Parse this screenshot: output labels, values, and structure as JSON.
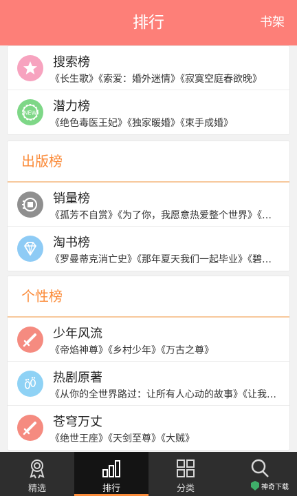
{
  "header": {
    "title": "排行",
    "shelf": "书架"
  },
  "card1": {
    "rows": [
      {
        "name": "搜索榜",
        "books": "《长生歌》《索爱：婚外迷情》《寂寞空庭春欲晚》",
        "icon": "star-icon",
        "color": "#f7a3bf"
      },
      {
        "name": "潜力榜",
        "books": "《绝色毒医王妃》《独家暖婚》《束手成婚》",
        "icon": "new-badge-icon",
        "color": "#7ed787"
      }
    ]
  },
  "publish": {
    "title": "出版榜",
    "rows": [
      {
        "name": "销量榜",
        "books": "《孤芳不自赏》《为了你，我愿意热爱整个世界》《…",
        "icon": "sales-ranking-icon",
        "color": "#8f8f8f"
      },
      {
        "name": "淘书榜",
        "books": "《罗曼蒂克消亡史》《那年夏天我们一起毕业》《碧…",
        "icon": "diamond-icon",
        "color": "#8ecbf5"
      }
    ]
  },
  "personal": {
    "title": "个性榜",
    "rows": [
      {
        "name": "少年风流",
        "books": "《帝焰神尊》《乡村少年》《万古之尊》",
        "icon": "sword-icon",
        "color": "#f58b80"
      },
      {
        "name": "热剧原著",
        "books": "《从你的全世界路过：让所有人心动的故事》《让我…",
        "icon": "footprint-icon",
        "color": "#8fd2f5"
      },
      {
        "name": "苍穹万丈",
        "books": "《绝世王座》《天剑至尊》《大贼》",
        "icon": "sword-icon",
        "color": "#f58b80"
      }
    ]
  },
  "tabs": [
    {
      "label": "精选",
      "icon": "award-icon"
    },
    {
      "label": "排行",
      "icon": "bar-chart-icon",
      "active": true
    },
    {
      "label": "分类",
      "icon": "grid-icon"
    },
    {
      "label": "",
      "icon": "search-icon"
    }
  ],
  "watermark": {
    "text": "神奇下载"
  },
  "colors": {
    "header": "#fd7f78",
    "accent": "#fb8c3b",
    "tabbar": "#2e2e2e"
  }
}
